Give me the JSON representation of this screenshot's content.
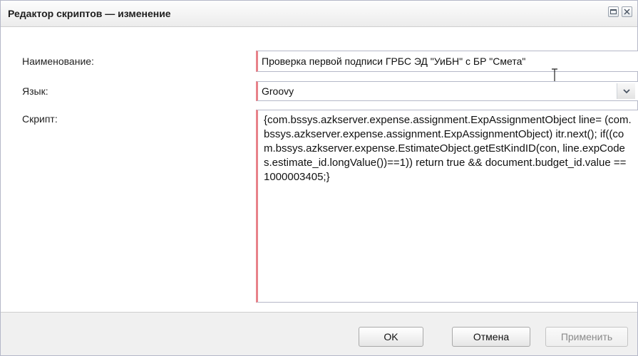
{
  "dialog": {
    "title": "Редактор скриптов — изменение",
    "maximize_icon": "maximize-icon",
    "close_icon": "close-icon"
  },
  "form": {
    "name_label": "Наименование:",
    "name_value": "Проверка первой подписи ГРБС ЭД \"УиБН\" с БР \"Смета\"",
    "language_label": "Язык:",
    "language_value": "Groovy",
    "language_dropdown_icon": "chevron-down-icon",
    "script_label": "Скрипт:",
    "script_value": "{com.bssys.azkserver.expense.assignment.ExpAssignmentObject line= (com.bssys.azkserver.expense.assignment.ExpAssignmentObject) itr.next(); if((com.bssys.azkserver.expense.EstimateObject.getEstKindID(con, line.expCodes.estimate_id.longValue())==1)) return true && document.budget_id.value == 1000003405;}"
  },
  "buttons": {
    "ok": "OK",
    "cancel": "Отмена",
    "apply": "Применить"
  },
  "colors": {
    "required_marker": "#e8828a",
    "title_bg": "#ececec",
    "footer_bg": "#f0f0f0"
  }
}
